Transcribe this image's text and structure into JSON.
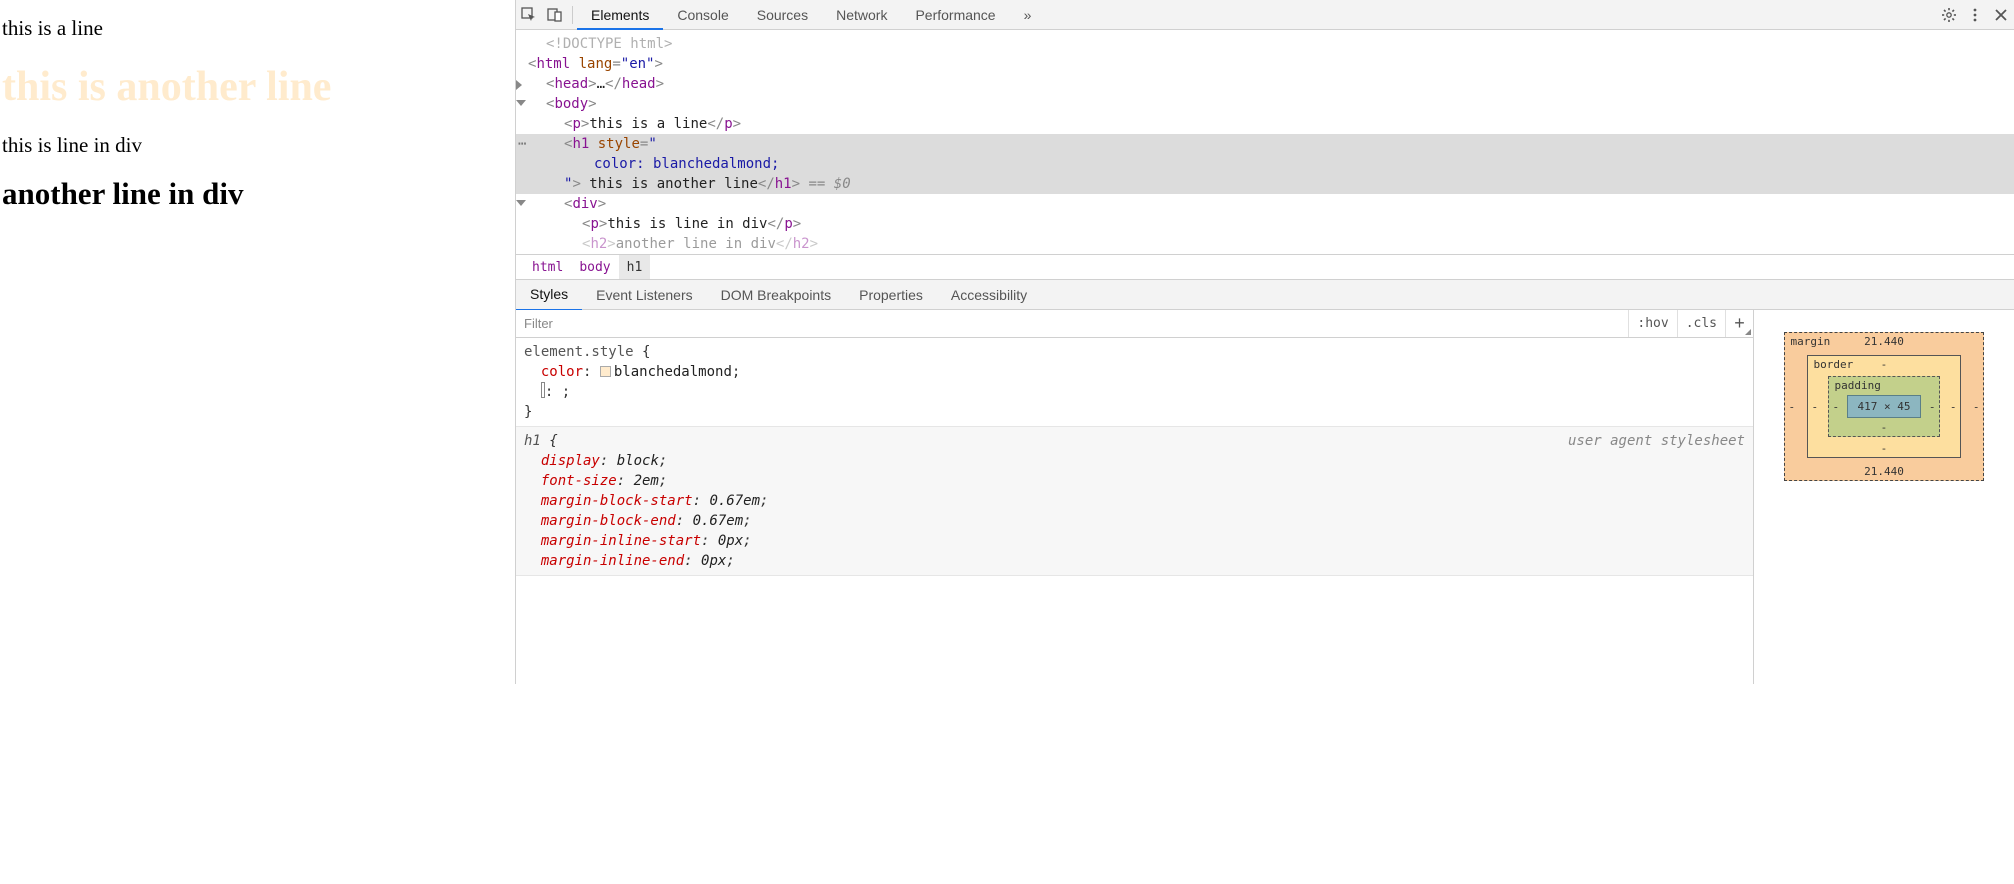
{
  "page": {
    "p1": "this is a line",
    "h1": "this is another line",
    "h1_color": "blanchedalmond",
    "p2": "this is line in div",
    "h2": "another line in div"
  },
  "toolbar": {
    "tabs": [
      "Elements",
      "Console",
      "Sources",
      "Network",
      "Performance"
    ],
    "more": "»",
    "active_tab": "Elements"
  },
  "elements": {
    "doctype": "<!DOCTYPE html>",
    "html_open_tag": "html",
    "html_attr_name": "lang",
    "html_attr_val": "en",
    "head_tag": "head",
    "head_ellipsis": "…",
    "body_tag": "body",
    "p_tag": "p",
    "p1_text": "this is a line",
    "h1_tag": "h1",
    "h1_attr": "style",
    "h1_style_line": "color: blanchedalmond;",
    "h1_text": " this is another line",
    "eq0": " == $0",
    "div_tag": "div",
    "p2_text": "this is line in div",
    "h2_tag": "h2",
    "h2_text": "another line in div",
    "selection_ellipsis": "⋯"
  },
  "breadcrumb": [
    "html",
    "body",
    "h1"
  ],
  "subtabs": [
    "Styles",
    "Event Listeners",
    "DOM Breakpoints",
    "Properties",
    "Accessibility"
  ],
  "styles": {
    "filter_placeholder": "Filter",
    "hov": ":hov",
    "cls": ".cls",
    "plus": "+",
    "rule1": {
      "selector": "element.style",
      "prop": "color",
      "val": "blanchedalmond",
      "editing": ": ;"
    },
    "rule2": {
      "selector": "h1",
      "origin": "user agent stylesheet",
      "decls": [
        {
          "prop": "display",
          "val": "block"
        },
        {
          "prop": "font-size",
          "val": "2em"
        },
        {
          "prop": "margin-block-start",
          "val": "0.67em"
        },
        {
          "prop": "margin-block-end",
          "val": "0.67em"
        },
        {
          "prop": "margin-inline-start",
          "val": "0px"
        },
        {
          "prop": "margin-inline-end",
          "val": "0px"
        }
      ]
    }
  },
  "boxmodel": {
    "margin_label": "margin",
    "margin_top": "21.440",
    "margin_bottom": "21.440",
    "margin_left": "-",
    "margin_right": "-",
    "border_label": "border",
    "border_top": "-",
    "border_bottom": "-",
    "border_left": "-",
    "border_right": "-",
    "padding_label": "padding",
    "padding_top": "",
    "padding_bottom": "-",
    "padding_left": "-",
    "padding_right": "-",
    "content": "417 × 45"
  }
}
